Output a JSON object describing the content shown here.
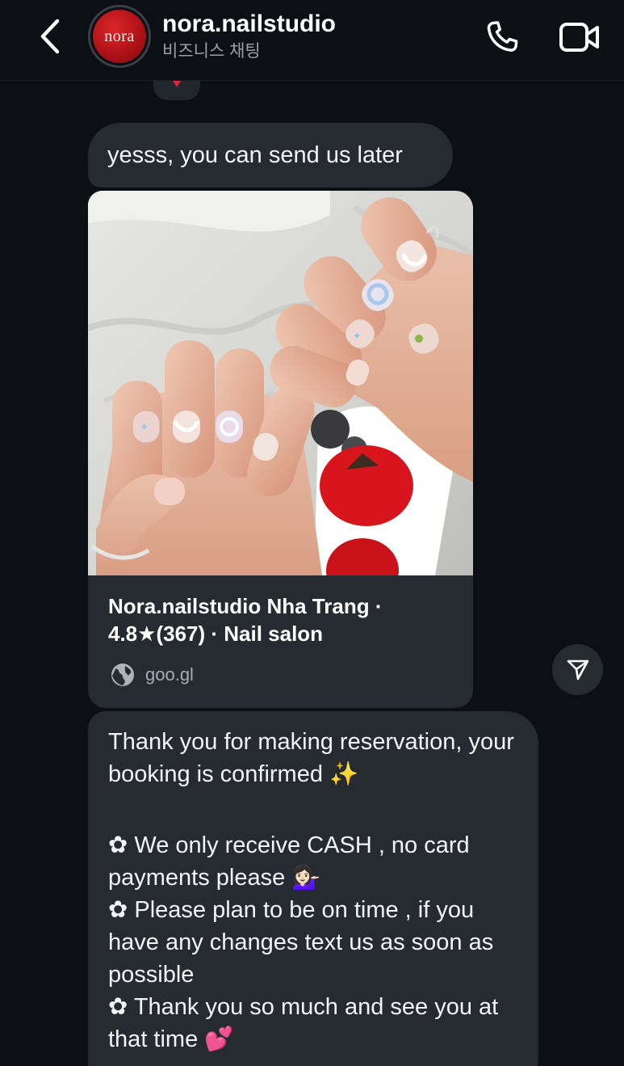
{
  "header": {
    "title": "nora.nailstudio",
    "subtitle": "비즈니스 채팅",
    "avatar_text": "nora",
    "back_icon": "chevron-left-icon",
    "call_icon": "phone-icon",
    "video_icon": "video-camera-icon"
  },
  "reaction": {
    "emoji": "♥",
    "color": "#e0283c"
  },
  "messages": [
    {
      "text": "yesss, you can send us later"
    },
    {
      "link_preview": {
        "title": "Nora.nailstudio Nha Trang · 4.8★(367) · Nail salon",
        "domain": "goo.gl",
        "domain_icon": "globe-icon",
        "image": "photo of manicured nails"
      }
    },
    {
      "paragraphs": [
        "Thank you for making reservation, your booking is confirmed ✨",
        "✿ We only receive CASH , no card payments please 💁🏻‍♀️",
        "✿ Please plan to be on time , if you have any changes text us as soon as possible",
        "✿ Thank you so much and see you at that time 💕"
      ]
    }
  ],
  "share_icon": "send-icon",
  "colors": {
    "background": "#0c0f14",
    "bubble": "#262a31",
    "muted_text": "#9aa0a8"
  }
}
